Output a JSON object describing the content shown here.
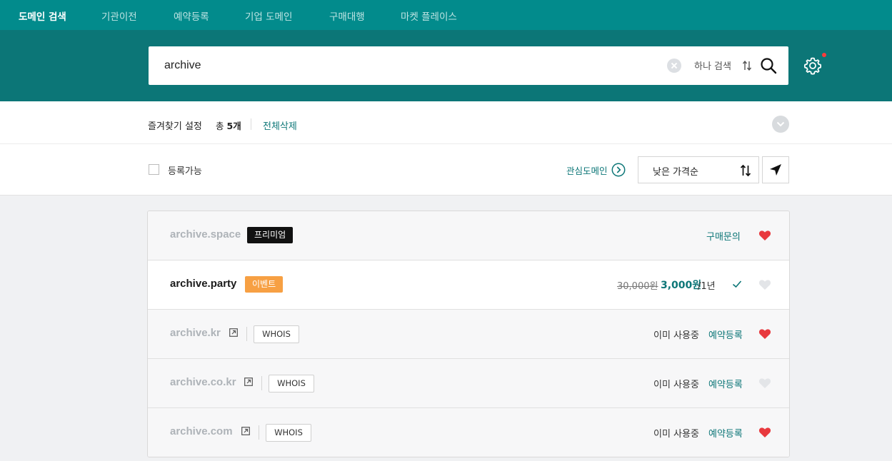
{
  "nav": {
    "tabs": [
      {
        "label": "도메인 검색",
        "active": true
      },
      {
        "label": "기관이전",
        "active": false
      },
      {
        "label": "예약등록",
        "active": false
      },
      {
        "label": "기업 도메인",
        "active": false
      },
      {
        "label": "구매대행",
        "active": false
      },
      {
        "label": "마켓 플레이스",
        "active": false
      }
    ]
  },
  "search": {
    "value": "archive",
    "single_search_label": "하나 검색"
  },
  "favorites": {
    "title": "즐겨찾기 설정",
    "count_prefix": "총",
    "count_value": "5개",
    "clear_all": "전체삭제"
  },
  "filter": {
    "available_label": "등록가능",
    "interest_domains": "관심도메인",
    "sort_selected": "낮은 가격순"
  },
  "colors": {
    "nav_bg": "#028b8c",
    "hero_bg": "#0c7677",
    "accent": "#0c7677",
    "heart_on": "#e8393e",
    "heart_off": "#e3e5e8",
    "premium_badge": "#111111",
    "event_badge": "#f7a043"
  },
  "results": [
    {
      "domain": "archive.space",
      "available": false,
      "badge": "프리미엄",
      "badge_type": "premium",
      "action": "구매문의",
      "favorited": true
    },
    {
      "domain": "archive.party",
      "available": true,
      "badge": "이벤트",
      "badge_type": "event",
      "original_price": "30,000원",
      "price": "3,000원",
      "period": "/1년",
      "favorited": false
    },
    {
      "domain": "archive.kr",
      "available": false,
      "whois": "WHOIS",
      "status": "이미 사용중",
      "action": "예약등록",
      "favorited": true
    },
    {
      "domain": "archive.co.kr",
      "available": false,
      "whois": "WHOIS",
      "status": "이미 사용중",
      "action": "예약등록",
      "favorited": false
    },
    {
      "domain": "archive.com",
      "available": false,
      "whois": "WHOIS",
      "status": "이미 사용중",
      "action": "예약등록",
      "favorited": true
    }
  ]
}
